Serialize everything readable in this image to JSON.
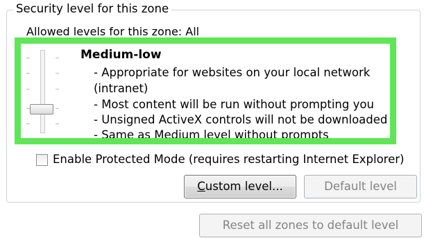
{
  "zone_security": {
    "group_title": "Security level for this zone",
    "allowed_levels": "Allowed levels for this zone: All",
    "slider": {
      "level_count": 4,
      "selected_level": 2,
      "highlight_color": "#5fe656"
    },
    "level": {
      "title": "Medium-low",
      "lines": [
        "- Appropriate for websites on your local network",
        "(intranet)",
        "- Most content will be run without prompting you",
        "- Unsigned ActiveX controls will not be downloaded",
        "- Same as Medium level without prompts"
      ]
    },
    "protected_mode": {
      "checked": false,
      "label": "Enable Protected Mode (requires restarting Internet Explorer)"
    },
    "buttons": {
      "custom_level": "Custom level...",
      "default_level": "Default level"
    }
  },
  "footer": {
    "reset_all": "Reset all zones to default level"
  }
}
